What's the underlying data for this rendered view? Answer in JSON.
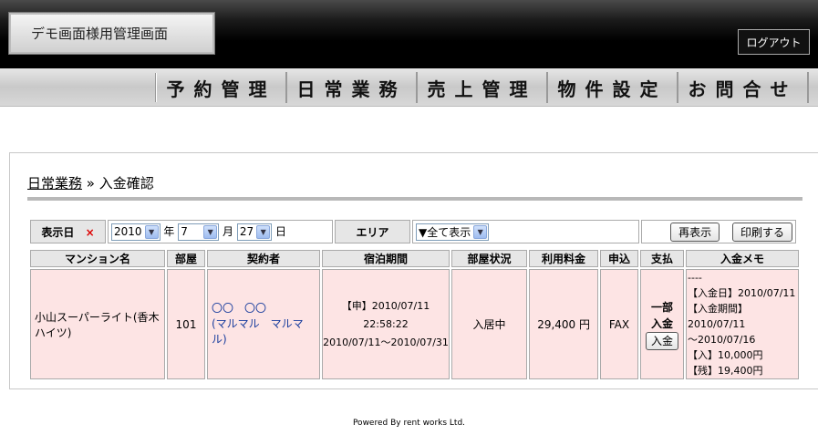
{
  "header": {
    "title": "デモ画面様用管理画面",
    "logout": "ログアウト"
  },
  "nav": [
    {
      "label": "予約管理"
    },
    {
      "label": "日常業務"
    },
    {
      "label": "売上管理"
    },
    {
      "label": "物件設定"
    },
    {
      "label": "お問合せ"
    }
  ],
  "breadcrumb": {
    "parent": "日常業務",
    "sep": " » ",
    "current": "入金確認"
  },
  "filter": {
    "date_label": "表示日",
    "required_mark": "×",
    "year": "2010",
    "year_unit": "年",
    "month": "7",
    "month_unit": "月",
    "day": "27",
    "day_unit": "日",
    "area_label": "エリア",
    "area_value": "▼全て表示",
    "refresh": "再表示",
    "print": "印刷する"
  },
  "table": {
    "headers": [
      "マンション名",
      "部屋",
      "契約者",
      "宿泊期間",
      "部屋状況",
      "利用料金",
      "申込",
      "支払",
      "入金メモ"
    ],
    "rows": [
      {
        "mansion": "小山スーパーライト(香木ハイツ)",
        "room": "101",
        "contractor_line1": "〇〇　〇〇",
        "contractor_line2": "(マルマル　マルマル)",
        "period_line1": "【申】2010/07/11 22:58:22",
        "period_line2": "2010/07/11～2010/07/31",
        "status": "入居中",
        "fee": "29,400 円",
        "apply": "FAX",
        "pay_status_1": "一部",
        "pay_status_2": "入金",
        "pay_button": "入金",
        "memo": [
          "----",
          "【入金日】2010/07/11",
          "【入金期間】2010/07/11",
          "～2010/07/16",
          "【入】10,000円",
          "【残】19,400円"
        ]
      }
    ]
  },
  "footer": "Powered By rent works Ltd."
}
